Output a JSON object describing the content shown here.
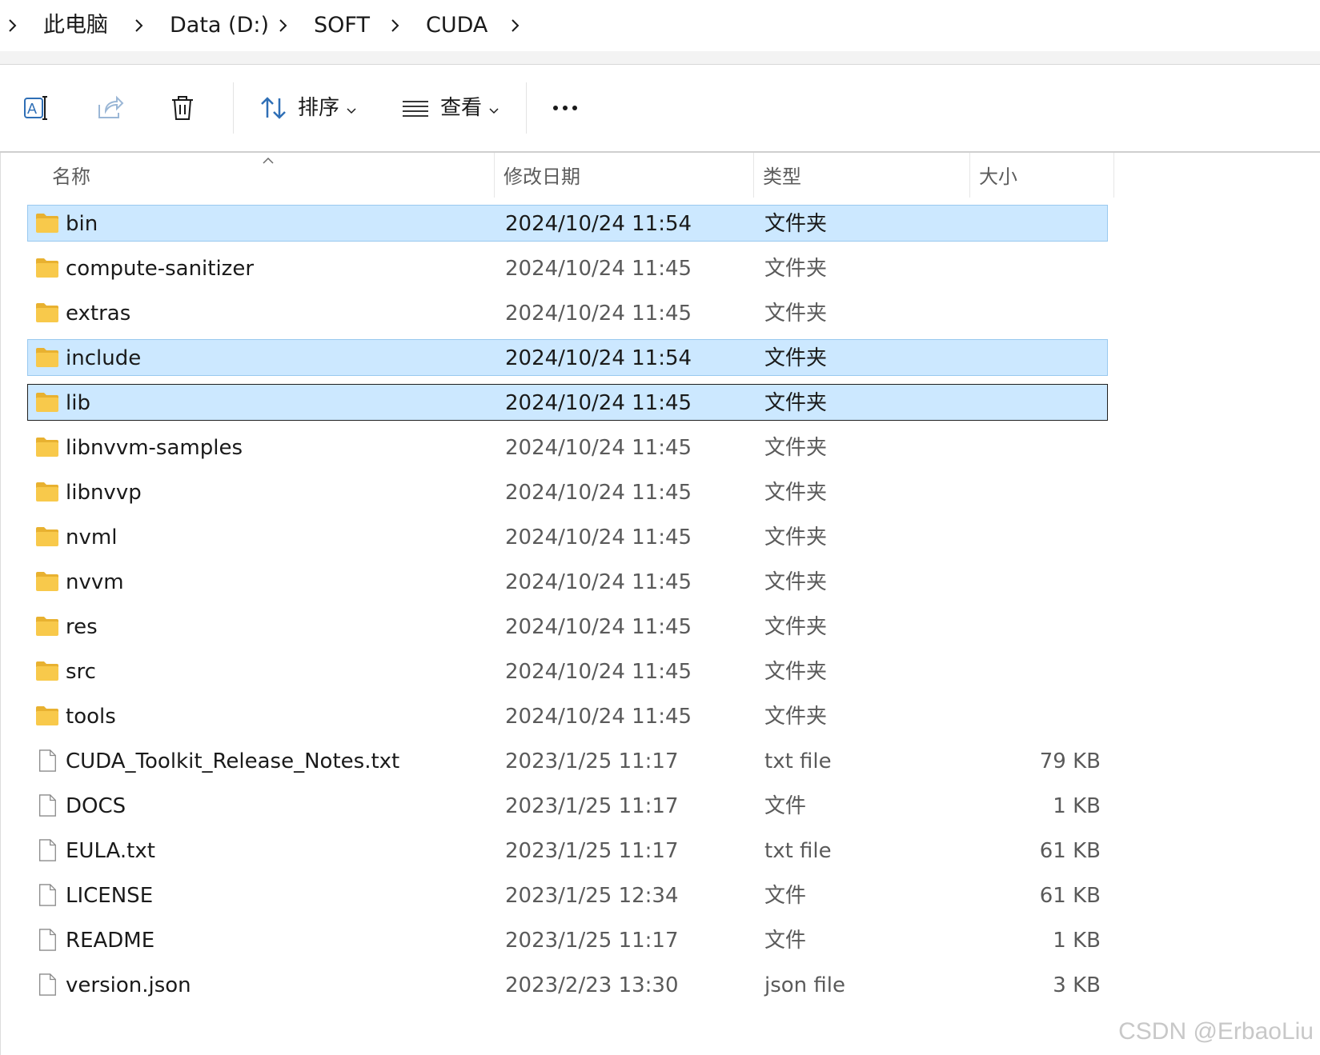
{
  "breadcrumb": {
    "items": [
      "此电脑",
      "Data (D:)",
      "SOFT",
      "CUDA"
    ]
  },
  "toolbar": {
    "sort_label": "排序",
    "view_label": "查看",
    "icons": [
      "rename-icon",
      "share-icon",
      "delete-icon",
      "sort-icon",
      "view-icon",
      "more-icon"
    ]
  },
  "columns": {
    "name": "名称",
    "date": "修改日期",
    "type": "类型",
    "size": "大小"
  },
  "files": [
    {
      "name": "bin",
      "date": "2024/10/24 11:54",
      "type": "文件夹",
      "size": "",
      "kind": "folder",
      "state": "selected"
    },
    {
      "name": "compute-sanitizer",
      "date": "2024/10/24 11:45",
      "type": "文件夹",
      "size": "",
      "kind": "folder",
      "state": ""
    },
    {
      "name": "extras",
      "date": "2024/10/24 11:45",
      "type": "文件夹",
      "size": "",
      "kind": "folder",
      "state": ""
    },
    {
      "name": "include",
      "date": "2024/10/24 11:54",
      "type": "文件夹",
      "size": "",
      "kind": "folder",
      "state": "selected"
    },
    {
      "name": "lib",
      "date": "2024/10/24 11:45",
      "type": "文件夹",
      "size": "",
      "kind": "folder",
      "state": "focused"
    },
    {
      "name": "libnvvm-samples",
      "date": "2024/10/24 11:45",
      "type": "文件夹",
      "size": "",
      "kind": "folder",
      "state": ""
    },
    {
      "name": "libnvvp",
      "date": "2024/10/24 11:45",
      "type": "文件夹",
      "size": "",
      "kind": "folder",
      "state": ""
    },
    {
      "name": "nvml",
      "date": "2024/10/24 11:45",
      "type": "文件夹",
      "size": "",
      "kind": "folder",
      "state": ""
    },
    {
      "name": "nvvm",
      "date": "2024/10/24 11:45",
      "type": "文件夹",
      "size": "",
      "kind": "folder",
      "state": ""
    },
    {
      "name": "res",
      "date": "2024/10/24 11:45",
      "type": "文件夹",
      "size": "",
      "kind": "folder",
      "state": ""
    },
    {
      "name": "src",
      "date": "2024/10/24 11:45",
      "type": "文件夹",
      "size": "",
      "kind": "folder",
      "state": ""
    },
    {
      "name": "tools",
      "date": "2024/10/24 11:45",
      "type": "文件夹",
      "size": "",
      "kind": "folder",
      "state": ""
    },
    {
      "name": "CUDA_Toolkit_Release_Notes.txt",
      "date": "2023/1/25 11:17",
      "type": "txt file",
      "size": "79 KB",
      "kind": "file",
      "state": ""
    },
    {
      "name": "DOCS",
      "date": "2023/1/25 11:17",
      "type": "文件",
      "size": "1 KB",
      "kind": "file",
      "state": ""
    },
    {
      "name": "EULA.txt",
      "date": "2023/1/25 11:17",
      "type": "txt file",
      "size": "61 KB",
      "kind": "file",
      "state": ""
    },
    {
      "name": "LICENSE",
      "date": "2023/1/25 12:34",
      "type": "文件",
      "size": "61 KB",
      "kind": "file",
      "state": ""
    },
    {
      "name": "README",
      "date": "2023/1/25 11:17",
      "type": "文件",
      "size": "1 KB",
      "kind": "file",
      "state": ""
    },
    {
      "name": "version.json",
      "date": "2023/2/23 13:30",
      "type": "json file",
      "size": "3 KB",
      "kind": "file",
      "state": ""
    }
  ],
  "watermark": "CSDN @ErbaoLiu",
  "colors": {
    "selection": "#cce8ff",
    "selection_border": "#99c9ef",
    "folder": "#f8c94b",
    "accent": "#005fb8"
  }
}
